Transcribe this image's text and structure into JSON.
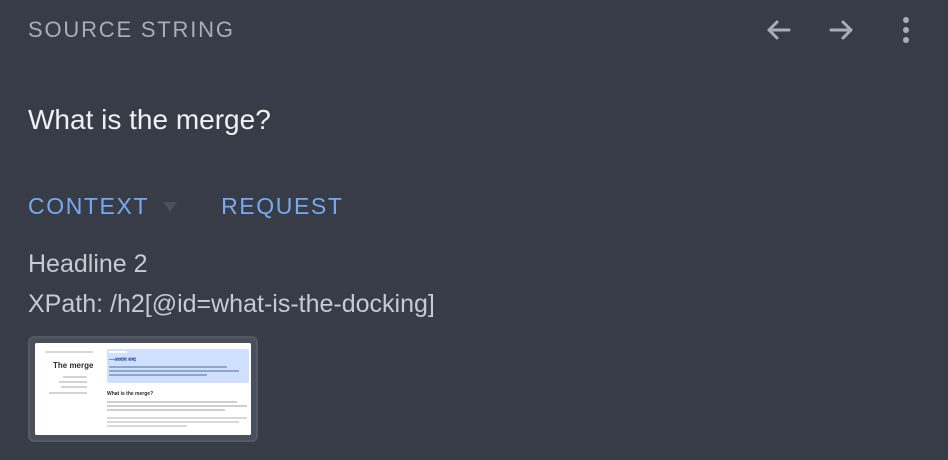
{
  "header": {
    "title": "SOURCE STRING",
    "back_icon": "arrow-left-icon",
    "forward_icon": "arrow-right-icon",
    "more_icon": "more-vert-icon"
  },
  "source": {
    "text": "What is the merge?"
  },
  "tabs": {
    "context_label": "CONTEXT",
    "request_label": "REQUEST"
  },
  "context": {
    "line1": "Headline 2",
    "line2": "XPath: /h2[@id=what-is-the-docking]"
  },
  "thumbnail": {
    "page_title": "The merge",
    "banner_heading": "—अध्याय शब्द",
    "section_heading": "What is the merge?"
  },
  "colors": {
    "background": "#373c47",
    "accent": "#78a8f0",
    "muted_text": "#a8adb7",
    "body_text": "#c6cad2",
    "thumbnail_banner": "#cfe0ff"
  }
}
